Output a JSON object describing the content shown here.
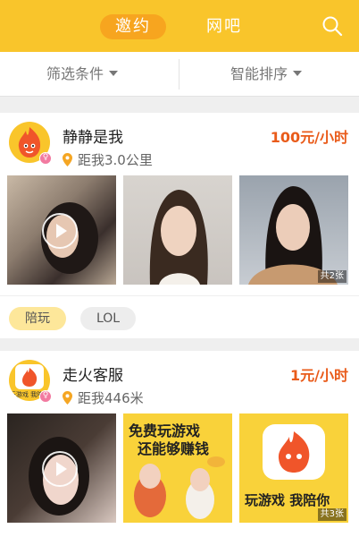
{
  "tabs": {
    "active": "邀约",
    "inactive": "网吧"
  },
  "filters": {
    "left": "筛选条件",
    "right": "智能排序"
  },
  "cards": [
    {
      "name": "静静是我",
      "price": "100元/小时",
      "distance": "距我3.0公里",
      "gender": "♀",
      "photo_count": "共2张",
      "tags": [
        "陪玩",
        "LOL"
      ]
    },
    {
      "name": "走火客服",
      "price": "1元/小时",
      "distance": "距我446米",
      "gender": "♀",
      "avatar_text": "玩游戏 我陪你",
      "poster_text_1": "免费玩游戏",
      "poster_text_2": "还能够赚钱",
      "logo_caption": "玩游戏 我陪你",
      "photo_count": "共3张"
    }
  ],
  "colors": {
    "accent": "#f9c52b",
    "tab_active": "#f7a51f",
    "price": "#e95b1a",
    "tag_active": "#fde79a"
  },
  "icons": [
    "search-icon",
    "location-pin-icon",
    "play-icon",
    "female-icon"
  ]
}
